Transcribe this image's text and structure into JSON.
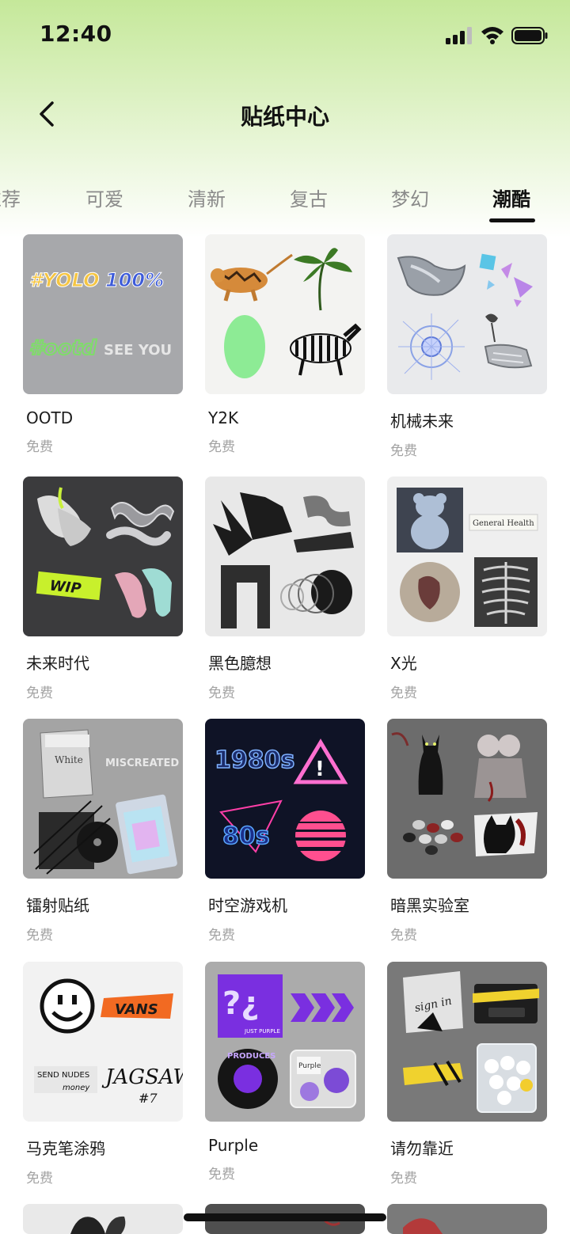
{
  "status": {
    "time": "12:40"
  },
  "header": {
    "title": "贴纸中心"
  },
  "tabs": [
    {
      "label": "推荐",
      "active": false
    },
    {
      "label": "可爱",
      "active": false
    },
    {
      "label": "清新",
      "active": false
    },
    {
      "label": "复古",
      "active": false
    },
    {
      "label": "梦幻",
      "active": false
    },
    {
      "label": "潮酷",
      "active": true
    }
  ],
  "stickers": [
    {
      "name": "OOTD",
      "price": "免费",
      "thumb_text": [
        "#YOLO",
        "100%",
        "#ootd",
        "SEE YOU"
      ]
    },
    {
      "name": "Y2K",
      "price": "免费"
    },
    {
      "name": "机械未来",
      "price": "免费"
    },
    {
      "name": "未来时代",
      "price": "免费",
      "thumb_text": [
        "WIP"
      ]
    },
    {
      "name": "黑色臆想",
      "price": "免费"
    },
    {
      "name": "X光",
      "price": "免费",
      "thumb_text": [
        "General Health"
      ]
    },
    {
      "name": "镭射贴纸",
      "price": "免费",
      "thumb_text": [
        "MISCREATED",
        "White"
      ]
    },
    {
      "name": "时空游戏机",
      "price": "免费",
      "thumb_text": [
        "1980s",
        "80s"
      ]
    },
    {
      "name": "暗黑实验室",
      "price": "免费"
    },
    {
      "name": "马克笔涂鸦",
      "price": "免费",
      "thumb_text": [
        "VANS",
        "JAGSAW",
        "#7",
        "SEND NUDES",
        "money"
      ]
    },
    {
      "name": "Purple",
      "price": "免费",
      "thumb_text": [
        "JUST PURPLE",
        "PRODUCES",
        "Purple"
      ]
    },
    {
      "name": "请勿靠近",
      "price": "免费",
      "thumb_text": [
        "sign in"
      ]
    }
  ],
  "colors": {
    "accent": "#111111",
    "header_green": "#c5e89a",
    "muted": "#a3a3a3"
  }
}
